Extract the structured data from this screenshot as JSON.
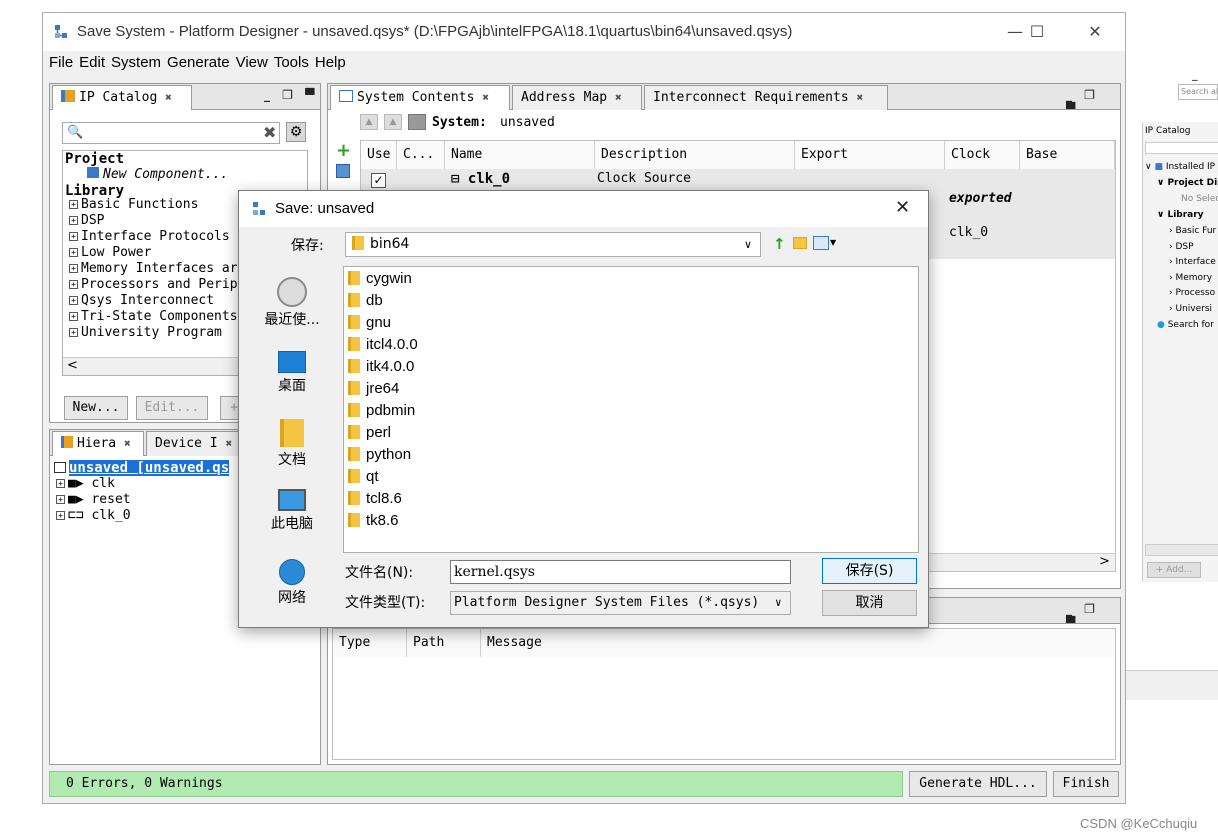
{
  "main_window": {
    "title": "Save System - Platform Designer - unsaved.qsys* (D:\\FPGAjb\\intelFPGA\\18.1\\quartus\\bin64\\unsaved.qsys)",
    "controls": {
      "minimize": "—",
      "maximize": "☐",
      "close": "✕"
    }
  },
  "menu": [
    "File",
    "Edit",
    "System",
    "Generate",
    "View",
    "Tools",
    "Help"
  ],
  "ip_catalog": {
    "tab": "IP Catalog",
    "project_label": "Project",
    "new_component": "New Component...",
    "library_label": "Library",
    "items": [
      "Basic Functions",
      "DSP",
      "Interface Protocols",
      "Low Power",
      "Memory Interfaces ar",
      "Processors and Perip",
      "Qsys Interconnect",
      "Tri-State Components",
      "University Program"
    ],
    "buttons": {
      "new": "New...",
      "edit": "Edit..."
    }
  },
  "hierarchy": {
    "tabs": [
      "Hiera",
      "Device I"
    ],
    "root": "unsaved [unsaved.qs",
    "items": [
      "clk",
      "reset",
      "clk_0"
    ]
  },
  "system_contents": {
    "tabs": [
      "System Contents",
      "Address Map",
      "Interconnect Requirements"
    ],
    "system_label": "System:",
    "system_name": "unsaved",
    "columns": [
      "Use",
      "C...",
      "Name",
      "Description",
      "Export",
      "Clock",
      "Base"
    ],
    "row": {
      "name": "clk_0",
      "description": "Clock Source",
      "export": "exported",
      "clock": "clk_0"
    }
  },
  "messages": {
    "columns": [
      "Type",
      "Path",
      "Message"
    ]
  },
  "status": {
    "text": "0 Errors, 0 Warnings",
    "generate_button": "Generate HDL...",
    "finish_button": "Finish"
  },
  "dialog": {
    "title": "Save: unsaved",
    "save_in_label": "保存:",
    "save_in_value": "bin64",
    "sidebar": [
      "最近使...",
      "桌面",
      "文档",
      "此电脑",
      "网络"
    ],
    "files": [
      "cygwin",
      "db",
      "gnu",
      "itcl4.0.0",
      "itk4.0.0",
      "jre64",
      "pdbmin",
      "perl",
      "python",
      "qt",
      "tcl8.6",
      "tk8.6"
    ],
    "filename_label": "文件名(N):",
    "filename_value": "kernel.qsys",
    "filetype_label": "文件类型(T):",
    "filetype_value": "Platform Designer System Files (*.qsys)",
    "save_button": "保存(S)",
    "cancel_button": "取消",
    "close": "✕"
  },
  "background_window": {
    "search_placeholder": "Search al",
    "ip_catalog": "IP Catalog",
    "installed_ip": "Installed IP",
    "project_dir": "Project Dire",
    "no_select": "No Selec",
    "library": "Library",
    "items": [
      "Basic Fur",
      "DSP",
      "Interface",
      "Memory",
      "Processo",
      "Universi"
    ],
    "search_for": "Search for",
    "add": "+ Add..."
  },
  "watermark": "CSDN @KeCchuqiu"
}
